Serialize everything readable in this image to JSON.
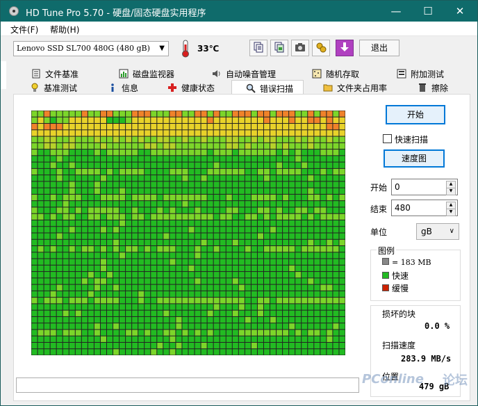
{
  "window": {
    "title": "HD Tune Pro 5.70 - 硬盘/固态硬盘实用程序",
    "minimize": "—",
    "maximize": "☐",
    "close": "✕"
  },
  "menu": {
    "file": "文件(F)",
    "help": "帮助(H)"
  },
  "toolbar": {
    "drive": "Lenovo SSD SL700 480G (480 gB)",
    "temperature": "33℃",
    "exit": "退出",
    "icons": [
      "copy-info-icon",
      "copy-screenshot-icon",
      "camera-icon",
      "options-icon",
      "save-icon"
    ]
  },
  "tabs_row1": [
    "文件基准",
    "磁盘监视器",
    "自动噪音管理",
    "随机存取",
    "附加测试"
  ],
  "tabs_row2": [
    "基准测试",
    "信息",
    "健康状态",
    "错误扫描",
    "文件夹占用率",
    "擦除"
  ],
  "active_tab": "错误扫描",
  "controls": {
    "start": "开始",
    "quick_scan": "快速扫描",
    "speed_map": "速度图",
    "start_label": "开始",
    "start_value": "0",
    "end_label": "结束",
    "end_value": "480",
    "unit_label": "单位",
    "unit_value": "gB"
  },
  "legend": {
    "title": "图例",
    "block": "= 183 MB",
    "fast": "快速",
    "slow": "缓慢"
  },
  "stats": {
    "damaged_label": "损坏的块",
    "damaged_value": "0.0 %",
    "speed_label": "扫描速度",
    "speed_value": "283.9 MB/s",
    "position_label": "位置",
    "position_value": "479 gB"
  },
  "colors": {
    "fast": "#22bb22",
    "slow": "#cc2200",
    "light_green": "#7cd62a",
    "yellow_green": "#b6d22a",
    "yellow": "#e8d22a",
    "orange": "#f0822a",
    "grid_line": "#222222",
    "gray": "#888888",
    "titlebar": "#0f6b6b"
  },
  "chart_data": {
    "type": "heatmap",
    "title": "",
    "columns": 50,
    "rows": 38,
    "block_size": "183 MB",
    "damaged_blocks_percent": 0.0,
    "legend": [
      "快速",
      "缓慢"
    ],
    "row_tint": {
      "0": "mixed_hot",
      "1": "mixed_hot",
      "2": "mixed_hot",
      "3": "mixed_warm",
      "4": "warm",
      "5": "warm",
      "6": "light",
      "9": "light",
      "13": "light",
      "15": "light",
      "16": "light",
      "21": "light",
      "29": "light",
      "34": "light"
    },
    "hot_row_pattern": [
      [
        "l",
        "l",
        "o",
        "l",
        "l",
        "l",
        "l",
        "l",
        "o",
        "l",
        "l",
        "o",
        "o",
        "l",
        "l",
        "l",
        "o",
        "o",
        "o",
        "l",
        "l",
        "l",
        "o",
        "o",
        "l",
        "l",
        "o",
        "o",
        "l",
        "o",
        "l",
        "l",
        "o",
        "o",
        "o",
        "l",
        "o",
        "o",
        "l",
        "o",
        "o",
        "o",
        "l",
        "l",
        "o",
        "l",
        "o",
        "o",
        "l",
        "o"
      ],
      [
        "l",
        "y",
        "l",
        "g",
        "l",
        "l",
        "y",
        "y",
        "y",
        "y",
        "y",
        "y",
        "g",
        "g",
        "g",
        "l",
        "y",
        "y",
        "y",
        "y",
        "y",
        "y",
        "y",
        "y",
        "y",
        "y",
        "y",
        "y",
        "o",
        "y",
        "y",
        "y",
        "y",
        "y",
        "y",
        "y",
        "y",
        "o",
        "y",
        "y",
        "y",
        "o",
        "y",
        "y",
        "o",
        "o",
        "y",
        "o",
        "y",
        "y"
      ],
      [
        "o",
        "y",
        "o",
        "o",
        "o",
        "y",
        "y",
        "y",
        "y",
        "y",
        "y",
        "y",
        "y",
        "y",
        "y",
        "y",
        "y",
        "y",
        "y",
        "y",
        "y",
        "y",
        "y",
        "y",
        "y",
        "y",
        "y",
        "y",
        "y",
        "y",
        "y",
        "y",
        "y",
        "y",
        "y",
        "y",
        "y",
        "y",
        "y",
        "y",
        "y",
        "y",
        "y",
        "y",
        "y",
        "y",
        "y",
        "o",
        "o",
        "y"
      ],
      [
        "y",
        "y",
        "y",
        "y",
        "y",
        "y",
        "y",
        "y",
        "y",
        "y",
        "y",
        "y",
        "y",
        "y",
        "y",
        "y",
        "y",
        "y",
        "y",
        "y",
        "y",
        "y",
        "y",
        "y",
        "y",
        "y",
        "y",
        "y",
        "y",
        "y",
        "y",
        "y",
        "y",
        "y",
        "y",
        "y",
        "y",
        "y",
        "y",
        "y",
        "y",
        "y",
        "y",
        "y",
        "y",
        "y",
        "y",
        "y",
        "y",
        "y"
      ]
    ]
  }
}
